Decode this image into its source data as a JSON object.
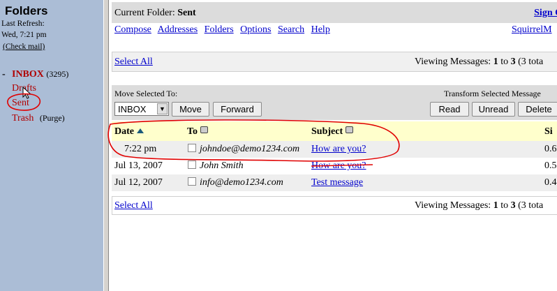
{
  "sidebar": {
    "title": "Folders",
    "last_refresh_label": "Last Refresh:",
    "last_refresh_time": "Wed, 7:21 pm",
    "check_mail": "(Check mail)",
    "collapse_glyph": "-",
    "inbox": {
      "label": "INBOX",
      "count": "(3295)"
    },
    "folders": [
      {
        "label": "Drafts"
      },
      {
        "label": "Sent"
      },
      {
        "label": "Trash",
        "extra": "(Purge)"
      }
    ]
  },
  "header": {
    "current_folder_label": "Current Folder:",
    "current_folder": "Sent",
    "sign_out": "Sign O",
    "nav": [
      "Compose",
      "Addresses",
      "Folders",
      "Options",
      "Search",
      "Help"
    ],
    "brand_link": "SquirrelM"
  },
  "list": {
    "select_all": "Select All",
    "viewing_label": "Viewing Messages:",
    "from": "1",
    "to_word": "to",
    "to": "3",
    "total_text": "(3 tota"
  },
  "actions": {
    "move_label": "Move Selected To:",
    "move_target": "INBOX",
    "move_button": "Move",
    "forward_button": "Forward",
    "transform_label": "Transform Selected Message",
    "read_button": "Read",
    "unread_button": "Unread",
    "delete_button": "Delete"
  },
  "table": {
    "columns": {
      "date": "Date",
      "to": "To",
      "subject": "Subject",
      "size": "Si"
    },
    "rows": [
      {
        "date": "7:22 pm",
        "to": "johndoe@demo1234.com",
        "subject": "How are you?",
        "size": "0.6"
      },
      {
        "date": "Jul 13, 2007",
        "to": "John Smith",
        "subject": "How are you?",
        "size": "0.5"
      },
      {
        "date": "Jul 12, 2007",
        "to": "info@demo1234.com",
        "subject": "Test message",
        "size": "0.4"
      }
    ]
  },
  "colors": {
    "sidebar_bg": "#abbdd6",
    "link": "#0000cc",
    "current_folder": "#b00000",
    "header_row": "#ffffcc",
    "annotation": "#e00000"
  }
}
